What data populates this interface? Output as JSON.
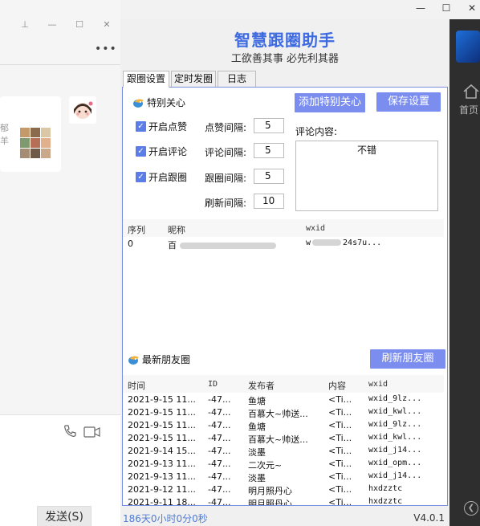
{
  "window_controls": {
    "pin": "⊥",
    "minimize": "—",
    "maximize": "☐",
    "close": "✕"
  },
  "chat": {
    "more": "•••",
    "left_text_1": "郁",
    "left_text_2": "羊",
    "send_label": "发送(S)"
  },
  "app": {
    "title": "智慧跟圈助手",
    "subtitle": "工欲善其事  必先利其器",
    "tabs": [
      {
        "label": "跟圈设置",
        "active": true
      },
      {
        "label": "定时发圈",
        "active": false
      },
      {
        "label": "日志",
        "active": false
      }
    ],
    "settings": {
      "section_title": "特别关心",
      "add_button": "添加特别关心",
      "save_button": "保存设置",
      "checkboxes": [
        {
          "label": "开启点赞",
          "checked": true
        },
        {
          "label": "开启评论",
          "checked": true
        },
        {
          "label": "开启跟圈",
          "checked": true
        }
      ],
      "intervals": [
        {
          "label": "点赞间隔:",
          "value": "5"
        },
        {
          "label": "评论间隔:",
          "value": "5"
        },
        {
          "label": "跟圈间隔:",
          "value": "5"
        },
        {
          "label": "刷新间隔:",
          "value": "10"
        }
      ],
      "comment_label": "评论内容:",
      "comment_value": "不错"
    },
    "special_table": {
      "headers": [
        "序列",
        "昵称",
        "wxid"
      ],
      "rows": [
        {
          "index": "0",
          "nickname": "百",
          "wxid_prefix": "w",
          "wxid_suffix": "24s7u..."
        }
      ]
    },
    "moments": {
      "section_title": "最新朋友圈",
      "refresh_button": "刷新朋友圈",
      "headers": [
        "时间",
        "ID",
        "发布者",
        "内容",
        "wxid"
      ],
      "rows": [
        {
          "time": "2021-9-15 11...",
          "id": "-47...",
          "author": "鱼塘",
          "content": "<Ti...",
          "wxid": "wxid_9lz..."
        },
        {
          "time": "2021-9-15 11...",
          "id": "-47...",
          "author": "百慕大~帅送...",
          "content": "<Ti...",
          "wxid": "wxid_kwl..."
        },
        {
          "time": "2021-9-15 11...",
          "id": "-47...",
          "author": "鱼塘",
          "content": "<Ti...",
          "wxid": "wxid_9lz..."
        },
        {
          "time": "2021-9-15 11...",
          "id": "-47...",
          "author": "百慕大~帅送...",
          "content": "<Ti...",
          "wxid": "wxid_kwl..."
        },
        {
          "time": "2021-9-14 15...",
          "id": "-47...",
          "author": "淡墨",
          "content": "<Ti...",
          "wxid": "wxid_j14..."
        },
        {
          "time": "2021-9-13 11...",
          "id": "-47...",
          "author": "二次元~",
          "content": "<Ti...",
          "wxid": "wxid_opm..."
        },
        {
          "time": "2021-9-13 11...",
          "id": "-47...",
          "author": "淡墨",
          "content": "<Ti...",
          "wxid": "wxid_j14..."
        },
        {
          "time": "2021-9-12 11...",
          "id": "-47...",
          "author": "明月照丹心",
          "content": "<Ti...",
          "wxid": "hxdzztc"
        },
        {
          "time": "2021-9-11 18...",
          "id": "-47...",
          "author": "明月照丹心",
          "content": "<Ti...",
          "wxid": "hxdzztc"
        }
      ]
    },
    "status": {
      "elapsed": "186天0小时0分0秒",
      "version": "V4.0.1"
    }
  },
  "sidebar_right": {
    "home_label": "首页"
  },
  "colors": {
    "accent": "#7b8ef0",
    "title_blue": "#3d6ae0",
    "checkbox": "#5c7ce8",
    "panel_border": "#7a8fe0",
    "dark_strip": "#2e2e2e"
  }
}
